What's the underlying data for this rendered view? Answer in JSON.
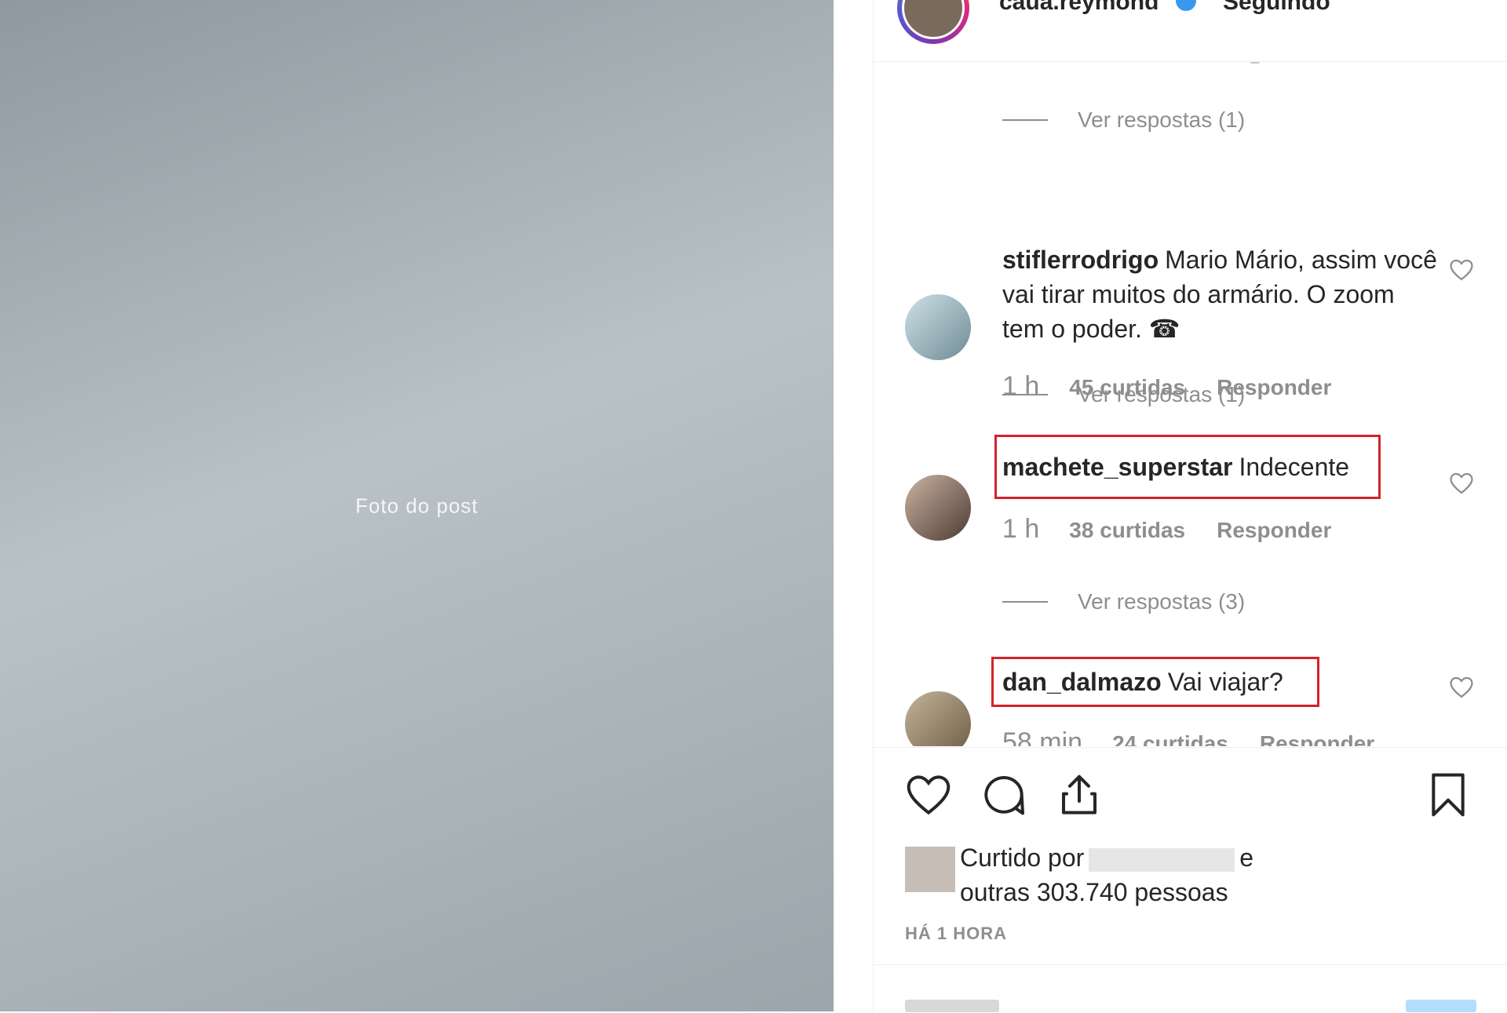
{
  "post": {
    "photo_alt": "Foto do post"
  },
  "header": {
    "username": "caua.reymond",
    "follow_status": "Seguindo"
  },
  "comments": {
    "replies_1": "Ver respostas (1)",
    "replies_2": "Ver respostas (1)",
    "replies_3": "Ver respostas (3)",
    "items": [
      {
        "user": "stiflerrodrigo",
        "text": "Mario Mário, assim você vai tirar muitos do armário. O zoom tem o poder.",
        "emoji": "☎",
        "time": "1 h",
        "likes": "45 curtidas",
        "reply": "Responder"
      },
      {
        "user": "machete_superstar",
        "text": "Indecente",
        "time": "1 h",
        "likes": "38 curtidas",
        "reply": "Responder"
      },
      {
        "user": "dan_dalmazo",
        "text": "Vai viajar?",
        "time": "58 min",
        "likes": "24 curtidas",
        "reply": "Responder"
      }
    ]
  },
  "actions": {
    "liked_by_prefix": "Curtido por",
    "liked_by_suffix": "e",
    "others": "outras 303.740 pessoas",
    "timestamp": "HÁ 1 HORA"
  },
  "icons": {
    "like": "heart-icon",
    "comment": "comment-bubble-icon",
    "share": "share-icon",
    "save": "bookmark-icon"
  },
  "colors": {
    "highlight": "#d3232a",
    "verified": "#3897f0"
  }
}
